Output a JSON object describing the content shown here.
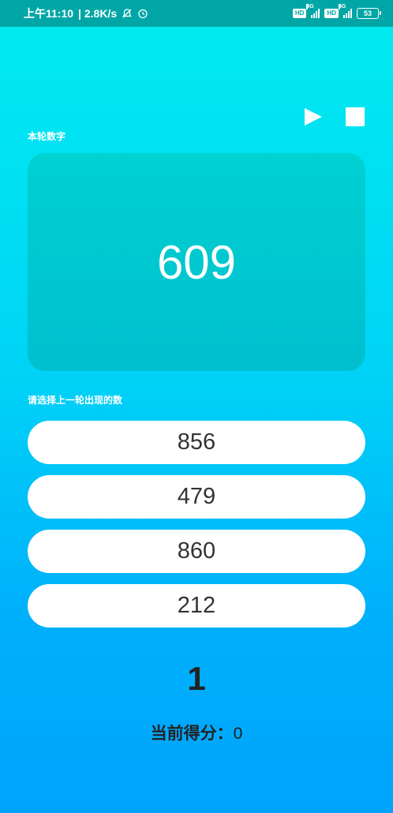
{
  "status_bar": {
    "time": "上午11:10",
    "speed": "| 2.8K/s",
    "sim1_hd": "HD",
    "sim1_net": "4G",
    "sim2_hd": "HD",
    "sim2_net": "4G",
    "battery": "53"
  },
  "controls": {
    "play_icon": "play-icon",
    "stop_icon": "stop-icon"
  },
  "current_round": {
    "label": "本轮数字",
    "number": "609"
  },
  "choice": {
    "label": "请选择上一轮出现的数",
    "options": [
      "856",
      "479",
      "860",
      "212"
    ]
  },
  "round_counter": "1",
  "score": {
    "label": "当前得分：",
    "value": "0"
  }
}
